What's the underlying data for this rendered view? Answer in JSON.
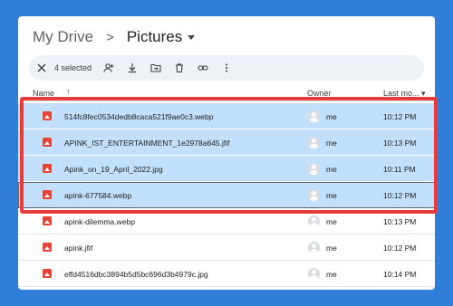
{
  "breadcrumb": {
    "root": "My Drive",
    "separator": ">",
    "current": "Pictures"
  },
  "toolbar": {
    "selected_count": "4 selected",
    "icons": [
      "close-icon",
      "share-icon",
      "download-icon",
      "move-icon",
      "trash-icon",
      "link-icon",
      "more-icon"
    ]
  },
  "columns": {
    "name": "Name",
    "sort_arrow": "↑",
    "owner": "Owner",
    "last_modified": "Last mo... ▾"
  },
  "files": [
    {
      "name": "514fc8fec0534dedb8caca521f9ae0c3.webp",
      "owner": "me",
      "modified": "10:12 PM",
      "selected": true
    },
    {
      "name": "APINK_IST_ENTERTAINMENT_1e2978a645.jfif",
      "owner": "me",
      "modified": "10:13 PM",
      "selected": true
    },
    {
      "name": "Apink_on_19_April_2022.jpg",
      "owner": "me",
      "modified": "10:11 PM",
      "selected": true
    },
    {
      "name": "apink-677584.webp",
      "owner": "me",
      "modified": "10:12 PM",
      "selected": true
    },
    {
      "name": "apink-dilemma.webp",
      "owner": "me",
      "modified": "10:13 PM",
      "selected": false
    },
    {
      "name": "apink.jfif",
      "owner": "me",
      "modified": "10:12 PM",
      "selected": false
    },
    {
      "name": "effd4516dbc3894b5d5bc696d3b4979c.jpg",
      "owner": "me",
      "modified": "10:14 PM",
      "selected": false
    }
  ],
  "colors": {
    "background": "#2f7ed8",
    "selection": "#c2e0fb",
    "highlight_border": "#e53c3c",
    "file_icon": "#e94235"
  }
}
